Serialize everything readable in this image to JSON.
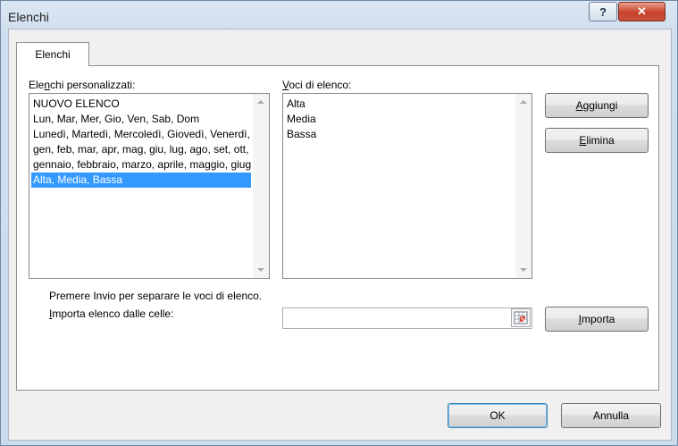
{
  "window": {
    "title": "Elenchi",
    "help_glyph": "?",
    "close_glyph": "✕"
  },
  "tabs": [
    {
      "label": "Elenchi"
    }
  ],
  "custom_lists": {
    "label_before": "Ele",
    "label_accel": "n",
    "label_after": "chi personalizzati:",
    "items": [
      "NUOVO ELENCO",
      "Lun, Mar, Mer, Gio, Ven, Sab, Dom",
      "Lunedì, Martedì, Mercoledì, Giovedì, Venerdì, Sabato, Domenica",
      "gen, feb, mar, apr, mag, giu, lug, ago, set, ott, nov, dic",
      "gennaio, febbraio, marzo, aprile, maggio, giugno, luglio, agosto, settembre, ottobre, novembre, dicembre",
      "Alta, Media, Bassa"
    ],
    "selected_index": 5
  },
  "list_entries": {
    "label_accel": "V",
    "label_after": "oci di elenco:",
    "items": [
      "Alta",
      "Media",
      "Bassa"
    ]
  },
  "buttons": {
    "add": {
      "accel": "A",
      "rest": "ggiungi"
    },
    "delete": {
      "accel": "E",
      "rest": "limina"
    },
    "import": {
      "accel": "I",
      "rest": "mporta"
    },
    "ok": "OK",
    "cancel": "Annulla"
  },
  "hint": "Premere Invio per separare le voci di elenco.",
  "import_from": {
    "label_accel": "I",
    "label_after": "mporta elenco dalle celle:",
    "value": ""
  },
  "colors": {
    "selection": "#3399ff",
    "close_button": "#c7402b"
  }
}
